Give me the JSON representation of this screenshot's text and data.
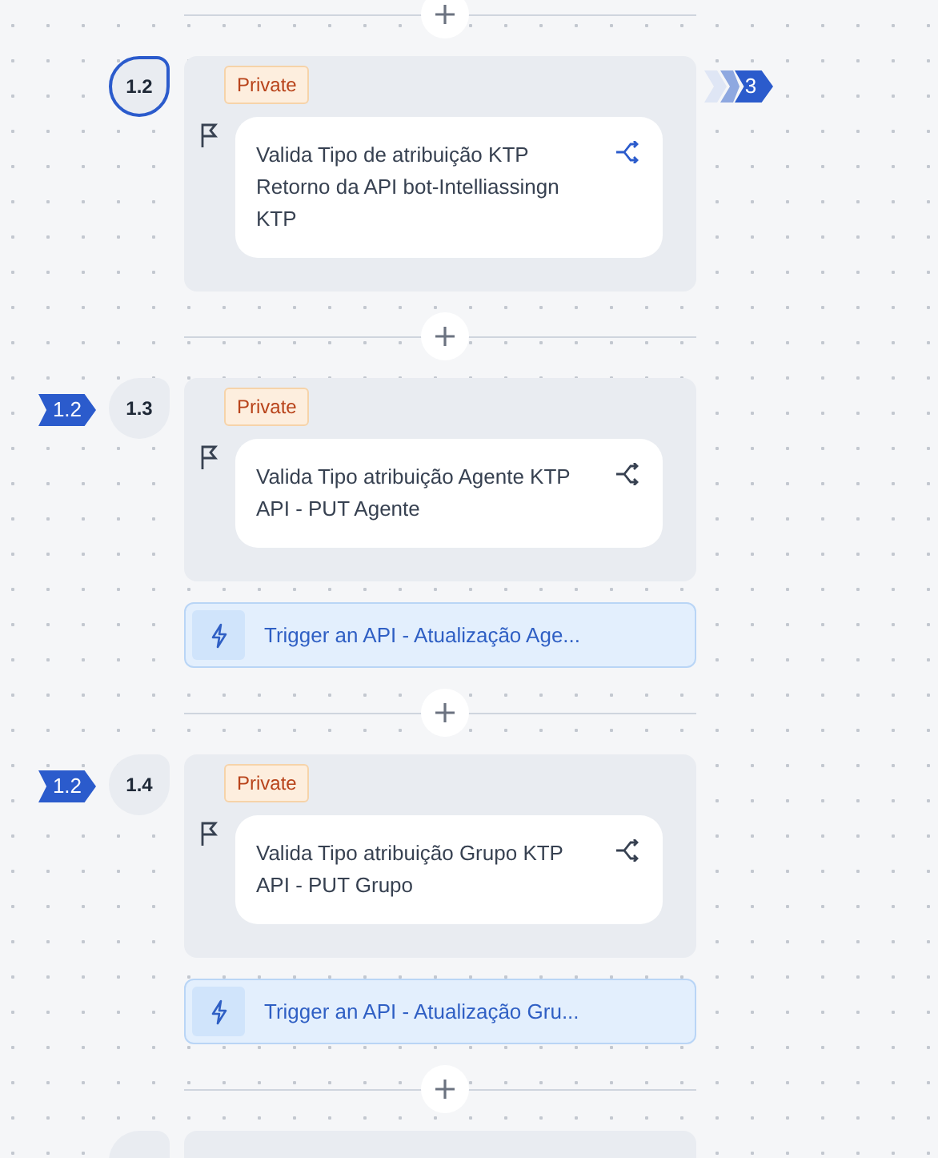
{
  "steps": [
    {
      "number": "1.2",
      "selected": true,
      "privacy": "Private",
      "title_lines": [
        "Valida Tipo de atribuição KTP",
        "Retorno da API bot-Intelliassingn",
        "KTP"
      ],
      "branch_count": "3"
    },
    {
      "number": "1.3",
      "selected": false,
      "source_tag": "1.2",
      "privacy": "Private",
      "title_lines": [
        "Valida Tipo atribuição Agente KTP",
        "API - PUT Agente"
      ],
      "action": "Trigger an API - Atualização Age..."
    },
    {
      "number": "1.4",
      "selected": false,
      "source_tag": "1.2",
      "privacy": "Private",
      "title_lines": [
        "Valida Tipo atribuição Grupo KTP",
        "API - PUT Grupo"
      ],
      "action": "Trigger an API - Atualização Gru..."
    },
    {
      "selected": false
    }
  ]
}
